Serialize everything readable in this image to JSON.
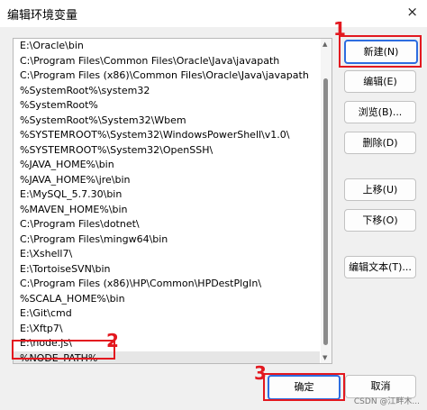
{
  "window": {
    "title": "编辑环境变量"
  },
  "paths": [
    "E:\\Oracle\\bin",
    "C:\\Program Files\\Common Files\\Oracle\\Java\\javapath",
    "C:\\Program Files (x86)\\Common Files\\Oracle\\Java\\javapath",
    "%SystemRoot%\\system32",
    "%SystemRoot%",
    "%SystemRoot%\\System32\\Wbem",
    "%SYSTEMROOT%\\System32\\WindowsPowerShell\\v1.0\\",
    "%SYSTEMROOT%\\System32\\OpenSSH\\",
    "%JAVA_HOME%\\bin",
    "%JAVA_HOME%\\jre\\bin",
    "E:\\MySQL_5.7.30\\bin",
    "%MAVEN_HOME%\\bin",
    "C:\\Program Files\\dotnet\\",
    "C:\\Program Files\\mingw64\\bin",
    "E:\\Xshell7\\",
    "E:\\TortoiseSVN\\bin",
    "C:\\Program Files (x86)\\HP\\Common\\HPDestPlgIn\\",
    "%SCALA_HOME%\\bin",
    "E:\\Git\\cmd",
    "E:\\Xftp7\\",
    "E:\\node.js\\",
    "%NODE_PATH%"
  ],
  "buttons": {
    "new": "新建(N)",
    "edit": "编辑(E)",
    "browse": "浏览(B)...",
    "delete": "删除(D)",
    "move_up": "上移(U)",
    "move_down": "下移(O)",
    "edit_text": "编辑文本(T)...",
    "ok": "确定",
    "cancel": "取消"
  },
  "annotations": {
    "one": "1",
    "two": "2",
    "three": "3"
  },
  "watermark": "CSDN @江畔木..."
}
